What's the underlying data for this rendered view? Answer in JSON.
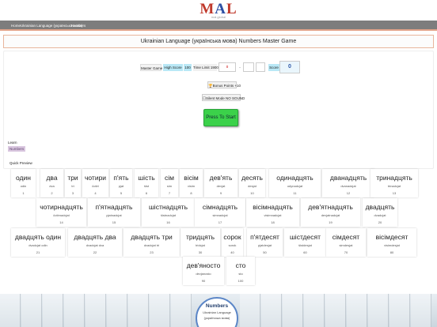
{
  "logo": {
    "text_m": "M",
    "text_a": "A",
    "text_l": "L",
    "sub": "mal.global"
  },
  "topbar": {
    "home": "Home",
    "course": "Ukrainian Language (українська мова)",
    "section": "Numbers"
  },
  "page_title": "Ukrainian Language (українська мова) Numbers Master Game",
  "controls": {
    "master_game": "Master Game",
    "high_score_label": "High Score",
    "high_score_value": "100",
    "time_limit_label": "Time Limit 1900",
    "time_value": "0",
    "dash": "-",
    "score_label": "Score",
    "score_value": "0",
    "bonus": "Bonus Points +10",
    "silent": "Silent Mode NO SOUND",
    "start": "Press To Start"
  },
  "learn": {
    "label": "Learn",
    "link": "Numbers"
  },
  "quick_preview": "Quick Preview",
  "cards": [
    {
      "word": "один",
      "translit": "odin",
      "num": "1"
    },
    {
      "word": "два",
      "translit": "dva",
      "num": "2"
    },
    {
      "word": "три",
      "translit": "tri",
      "num": "3"
    },
    {
      "word": "чотири",
      "translit": "čotiri",
      "num": "4"
    },
    {
      "word": "п'ять",
      "translit": "pjat",
      "num": "5"
    },
    {
      "word": "шість",
      "translit": "šist",
      "num": "6"
    },
    {
      "word": "сім",
      "translit": "sim",
      "num": "7"
    },
    {
      "word": "вісім",
      "translit": "visim",
      "num": "8"
    },
    {
      "word": "дев'ять",
      "translit": "devjat",
      "num": "9"
    },
    {
      "word": "десять",
      "translit": "desjat",
      "num": "10"
    },
    {
      "word": "одинадцять",
      "translit": "odynadcjat",
      "num": "11"
    },
    {
      "word": "дванадцять",
      "translit": "dvanadcjat",
      "num": "12"
    },
    {
      "word": "тринадцять",
      "translit": "trinadcjat",
      "num": "13"
    },
    {
      "word": "чотирнадцять",
      "translit": "čotirnadcjat",
      "num": "14"
    },
    {
      "word": "п'ятнадцять",
      "translit": "pjatnadcjat",
      "num": "15"
    },
    {
      "word": "шістнадцять",
      "translit": "šistnadcjat",
      "num": "16"
    },
    {
      "word": "сімнадцять",
      "translit": "simnadcjat",
      "num": "17"
    },
    {
      "word": "вісімнадцять",
      "translit": "visimnadcjat",
      "num": "18"
    },
    {
      "word": "дев'ятнадцять",
      "translit": "devjatnadcjat",
      "num": "19"
    },
    {
      "word": "двадцять",
      "translit": "dvadcjat",
      "num": "20"
    },
    {
      "word": "двадцять один",
      "translit": "dvadcjat odin",
      "num": "21"
    },
    {
      "word": "двадцять два",
      "translit": "dvadcjat dva",
      "num": "22"
    },
    {
      "word": "двадцять три",
      "translit": "dvadcjat tri",
      "num": "23"
    },
    {
      "word": "тридцять",
      "translit": "tridcjat",
      "num": "30"
    },
    {
      "word": "сорок",
      "translit": "sorok",
      "num": "40"
    },
    {
      "word": "п'ятдесят",
      "translit": "pjatdesjat",
      "num": "50"
    },
    {
      "word": "шістдесят",
      "translit": "šistdesjat",
      "num": "60"
    },
    {
      "word": "сімдесят",
      "translit": "simdesjat",
      "num": "70"
    },
    {
      "word": "вісімдесят",
      "translit": "visimdesjat",
      "num": "80"
    },
    {
      "word": "дев'яносто",
      "translit": "devjanosto",
      "num": "90"
    },
    {
      "word": "сто",
      "translit": "sto",
      "num": "100"
    }
  ],
  "promo": {
    "title": "Numbers",
    "line1": "Ukrainian Language",
    "line2": "(українська мова)"
  }
}
